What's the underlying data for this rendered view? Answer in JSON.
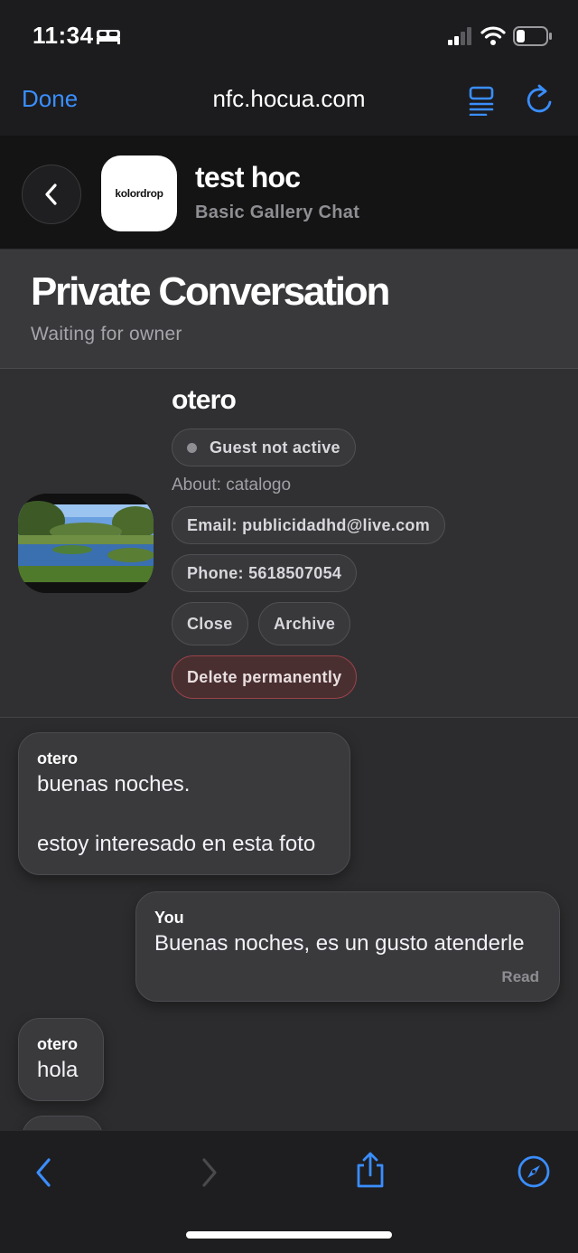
{
  "status_bar": {
    "time": "11:34",
    "icons": [
      "bed-icon",
      "signal-icon",
      "wifi-icon",
      "battery-icon"
    ]
  },
  "browser": {
    "done_label": "Done",
    "url": "nfc.hocua.com",
    "accent_color": "#3a8eff"
  },
  "chat_header": {
    "logo_text": "kolordrop",
    "title": "test hoc",
    "subtitle": "Basic Gallery Chat"
  },
  "conversation": {
    "title": "Private Conversation",
    "status": "Waiting for owner"
  },
  "guest": {
    "name": "otero",
    "status": "Guest not active",
    "about": "About: catalogo",
    "email": "Email: publicidadhd@live.com",
    "phone": "Phone: 5618507054",
    "actions": {
      "close": "Close",
      "archive": "Archive",
      "delete": "Delete permanently"
    }
  },
  "messages": [
    {
      "author": "otero",
      "text": "buenas noches.\n\nestoy interesado en esta foto",
      "side": "left"
    },
    {
      "author": "You",
      "text": "Buenas noches, es un gusto atenderle",
      "receipt": "Read",
      "side": "right"
    },
    {
      "author": "otero",
      "text": "hola",
      "side": "left"
    }
  ],
  "toolbar": {
    "icons": [
      "back-icon",
      "forward-icon",
      "share-icon",
      "compass-icon"
    ]
  }
}
